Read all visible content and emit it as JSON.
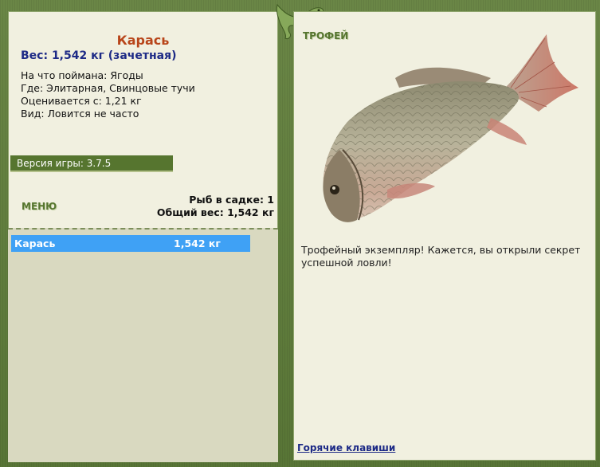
{
  "fish_info": {
    "title": "Карась",
    "weight": "Вес: 1,542 кг (зачетная)",
    "bait": "На что поймана: Ягоды",
    "location": "Где: Элитарная, Свинцовые тучи",
    "rated_from": "Оценивается с: 1,21 кг",
    "species": "Вид: Ловится не часто"
  },
  "version": "Версия игры: 3.7.5",
  "menu": {
    "label": "МЕНЮ"
  },
  "cage": {
    "fish_count": "Рыб в садке: 1",
    "total_weight": "Общий вес: 1,542 кг"
  },
  "catch_list": [
    {
      "name": "Карась",
      "weight": "1,542 кг"
    }
  ],
  "trophy": {
    "label": "ТРОФЕЙ",
    "text": "Трофейный экземпляр! Кажется, вы открыли секрет успешной ловли!"
  },
  "hotkeys": "Горячие клавиши",
  "colors": {
    "frame_green": "#5d7a3c",
    "panel_bg": "#f1f0e0",
    "title_orange": "#b8451a",
    "weight_blue": "#1d2a86",
    "selection_blue": "#3fa1f5"
  },
  "icons": [
    "lizard-icon",
    "fish-image"
  ]
}
